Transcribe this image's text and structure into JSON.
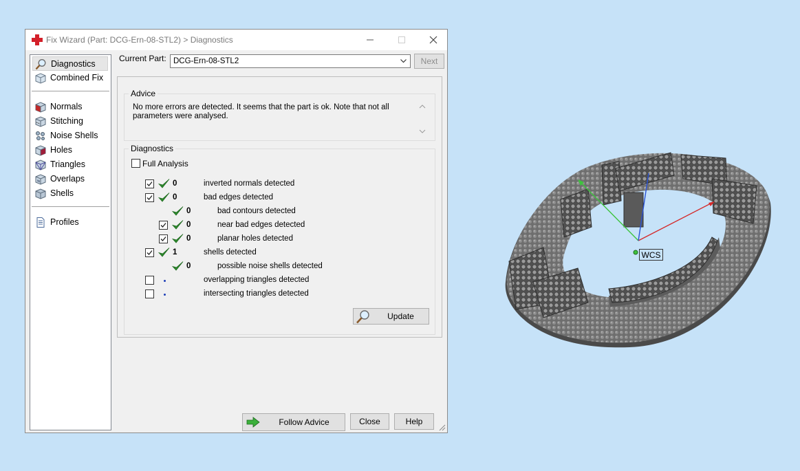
{
  "window": {
    "title": "Fix Wizard (Part: DCG-Ern-08-STL2) > Diagnostics"
  },
  "nav": {
    "items": [
      {
        "label": "Diagnostics",
        "icon": "magnifier-icon",
        "selected": true
      },
      {
        "label": "Combined Fix",
        "icon": "cube-combined-icon"
      },
      {
        "label": "Normals",
        "icon": "cube-normals-icon"
      },
      {
        "label": "Stitching",
        "icon": "cube-stitching-icon"
      },
      {
        "label": "Noise Shells",
        "icon": "cube-noise-icon"
      },
      {
        "label": "Holes",
        "icon": "cube-holes-icon"
      },
      {
        "label": "Triangles",
        "icon": "cube-triangles-icon"
      },
      {
        "label": "Overlaps",
        "icon": "cube-overlaps-icon"
      },
      {
        "label": "Shells",
        "icon": "cube-shells-icon"
      },
      {
        "label": "Profiles",
        "icon": "document-icon"
      }
    ]
  },
  "current_part": {
    "label": "Current Part:",
    "value": "DCG-Ern-08-STL2",
    "next_label": "Next"
  },
  "advice": {
    "legend": "Advice",
    "text": "No more errors are detected. It seems that the part is ok. Note that not all parameters were analysed."
  },
  "diagnostics": {
    "legend": "Diagnostics",
    "full_analysis_label": "Full Analysis",
    "rows": [
      {
        "checked": true,
        "status": "ok",
        "count": "0",
        "text": "inverted normals detected"
      },
      {
        "checked": true,
        "status": "ok",
        "count": "0",
        "text": "bad edges detected"
      },
      {
        "checkbox": false,
        "status": "ok",
        "count": "0",
        "text": "bad contours detected"
      },
      {
        "checked": true,
        "status": "ok",
        "count": "0",
        "text": "near bad edges detected"
      },
      {
        "checked": true,
        "status": "ok",
        "count": "0",
        "text": "planar holes detected"
      },
      {
        "checked": true,
        "status": "ok",
        "count": "1",
        "text": "shells detected"
      },
      {
        "checkbox": false,
        "status": "ok",
        "count": "0",
        "text": "possible noise shells detected"
      },
      {
        "checked": false,
        "status": "unknown",
        "count": "",
        "text": "overlapping triangles detected"
      },
      {
        "checked": false,
        "status": "unknown",
        "count": "",
        "text": "intersecting triangles detected"
      }
    ],
    "update_label": "Update"
  },
  "footer": {
    "follow_advice_label": "Follow Advice",
    "close_label": "Close",
    "help_label": "Help"
  },
  "viewport": {
    "wcs_label": "WCS"
  },
  "colors": {
    "desktop": "#c6e2f8",
    "ok_tick": "#2e8b2e",
    "axis_x": "#d42a2a",
    "axis_y": "#3ec43e",
    "axis_z": "#2a52d4"
  }
}
